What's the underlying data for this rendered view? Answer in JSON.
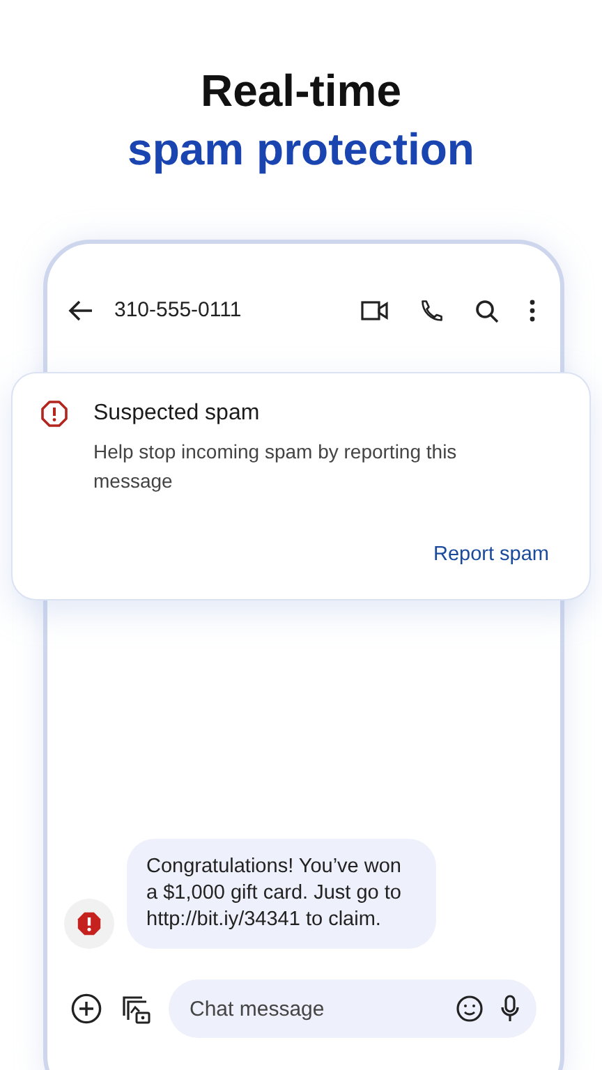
{
  "headline": {
    "line_1": "Real-time",
    "line_2": "spam protection"
  },
  "top_bar": {
    "title": "310-555-0111"
  },
  "spam_card": {
    "title": "Suspected spam",
    "body": "Help stop incoming spam by reporting this message",
    "action": "Report spam"
  },
  "messages": [
    {
      "text": "Congratulations! You’ve won a $1,000 gift card. Just go to http://bit.iy/34341 to claim.",
      "spam": true
    }
  ],
  "composer": {
    "placeholder": "Chat message"
  }
}
